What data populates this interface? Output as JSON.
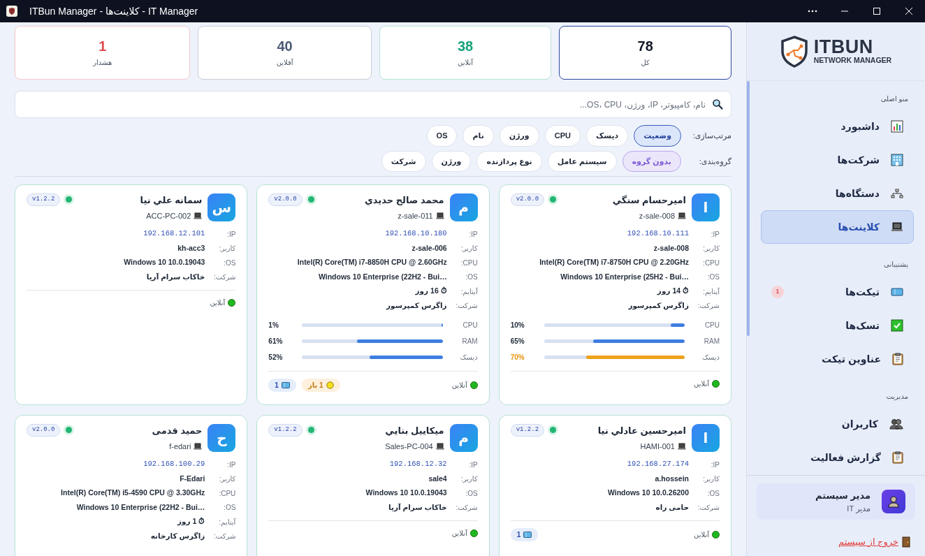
{
  "window": {
    "title": "ITBun Manager - کلاینت‌ها - IT Manager"
  },
  "stats": [
    {
      "value": "78",
      "label": "کل",
      "color": "#111827",
      "selected": true
    },
    {
      "value": "38",
      "label": "آنلاین",
      "color": "#16a37a",
      "selected": false
    },
    {
      "value": "40",
      "label": "آفلاین",
      "color": "#4b5a75",
      "selected": false
    },
    {
      "value": "1",
      "label": "هشدار",
      "color": "#e14b50",
      "selected": false
    }
  ],
  "search": {
    "placeholder": "نام، کامپیوتر، IP، ورژن، OS، CPU..."
  },
  "sort": {
    "label": "مرتب‌سازی:",
    "options": [
      {
        "label": "وضعیت",
        "selected": true
      },
      {
        "label": "دیسک",
        "selected": false
      },
      {
        "label": "CPU",
        "selected": false
      },
      {
        "label": "ورژن",
        "selected": false
      },
      {
        "label": "نام",
        "selected": false
      },
      {
        "label": "OS",
        "selected": false
      }
    ]
  },
  "grouping": {
    "label": "گروه‌بندی:",
    "options": [
      {
        "label": "بدون گروه",
        "selected": true
      },
      {
        "label": "سیستم عامل",
        "selected": false
      },
      {
        "label": "نوع پردازنده",
        "selected": false
      },
      {
        "label": "ورژن",
        "selected": false
      },
      {
        "label": "شرکت",
        "selected": false
      }
    ]
  },
  "clients": [
    {
      "initial": "ا",
      "name": "امیرحسام سنگي",
      "host": "z-sale-008",
      "version": "v2.0.0",
      "online": true,
      "fields": [
        {
          "label": "IP:",
          "value": "192.168.10.111",
          "kind": "ip"
        },
        {
          "label": "کاربر:",
          "value": "z-sale-008",
          "kind": "text"
        },
        {
          "label": "CPU:",
          "value": "Intel(R) Core(TM) i7-8750H CPU @ 2.20GHz",
          "kind": "text"
        },
        {
          "label": "OS:",
          "value": "Windows 10 Enterprise (25H2 - Bui…",
          "kind": "text"
        },
        {
          "label": "آپتایم:",
          "value": "⏱ 14 روز",
          "kind": "text"
        },
        {
          "label": "شرکت:",
          "value": "زاگرس کمپرسور",
          "kind": "text"
        }
      ],
      "metrics": [
        {
          "label": "CPU",
          "level": 0.1,
          "reading": "10%",
          "warning": false
        },
        {
          "label": "RAM",
          "level": 0.65,
          "reading": "65%",
          "warning": false
        },
        {
          "label": "دیسک",
          "level": 0.7,
          "reading": "70%",
          "warning": true
        }
      ],
      "status": "آنلاین"
    },
    {
      "initial": "م",
      "name": "محمد صالح حديدي",
      "host": "z-sale-011",
      "version": "v2.0.0",
      "online": true,
      "fields": [
        {
          "label": "IP:",
          "value": "192.168.10.180",
          "kind": "ip"
        },
        {
          "label": "کاربر:",
          "value": "z-sale-006",
          "kind": "text"
        },
        {
          "label": "CPU:",
          "value": "Intel(R) Core(TM) i7-8850H CPU @ 2.60GHz",
          "kind": "text"
        },
        {
          "label": "OS:",
          "value": "Windows 10 Enterprise (22H2 - Bui…",
          "kind": "text"
        },
        {
          "label": "آپتایم:",
          "value": "⏱ 16 روز",
          "kind": "text"
        },
        {
          "label": "شرکت:",
          "value": "زاگرس کمپرسور",
          "kind": "text"
        }
      ],
      "metrics": [
        {
          "label": "CPU",
          "level": 0.01,
          "reading": "1%",
          "warning": false
        },
        {
          "label": "RAM",
          "level": 0.61,
          "reading": "61%",
          "warning": false
        },
        {
          "label": "دیسک",
          "level": 0.52,
          "reading": "52%",
          "warning": false
        }
      ],
      "status": "آنلاین",
      "badges": [
        {
          "kind": "open",
          "text": "1 باز"
        },
        {
          "kind": "tickets",
          "text": "1"
        }
      ]
    },
    {
      "initial": "س",
      "name": "سمانه علي نيا",
      "host": "ACC-PC-002",
      "version": "v1.2.2",
      "online": true,
      "fields": [
        {
          "label": "IP:",
          "value": "192.168.12.101",
          "kind": "ip"
        },
        {
          "label": "کاربر:",
          "value": "kh-acc3",
          "kind": "text"
        },
        {
          "label": "OS:",
          "value": "Windows 10 10.0.19043",
          "kind": "text"
        },
        {
          "label": "شرکت:",
          "value": "خاکاب سرام آریا",
          "kind": "text"
        }
      ],
      "status": "آنلاین"
    },
    {
      "initial": "ا",
      "name": "امیرحسین عادلي نيا",
      "host": "HAMI-001",
      "version": "v1.2.2",
      "online": true,
      "fields": [
        {
          "label": "IP:",
          "value": "192.168.27.174",
          "kind": "ip"
        },
        {
          "label": "کاربر:",
          "value": "a.hossein",
          "kind": "text"
        },
        {
          "label": "OS:",
          "value": "Windows 10 10.0.26200",
          "kind": "text"
        },
        {
          "label": "شرکت:",
          "value": "حامی راه",
          "kind": "text"
        }
      ],
      "status": "آنلاین",
      "badges": [
        {
          "kind": "tickets",
          "text": "1"
        }
      ]
    },
    {
      "initial": "م",
      "name": "ميكاييل بنايي",
      "host": "Sales-PC-004",
      "version": "v1.2.2",
      "online": true,
      "fields": [
        {
          "label": "IP:",
          "value": "192.168.12.32",
          "kind": "ip"
        },
        {
          "label": "کاربر:",
          "value": "sale4",
          "kind": "text"
        },
        {
          "label": "OS:",
          "value": "Windows 10 10.0.19043",
          "kind": "text"
        },
        {
          "label": "شرکت:",
          "value": "خاکاب سرام آریا",
          "kind": "text"
        }
      ],
      "status": "آنلاین"
    },
    {
      "initial": "ح",
      "name": "حمید قدمی",
      "host": "f-edari",
      "version": "v2.0.0",
      "online": true,
      "fields": [
        {
          "label": "IP:",
          "value": "192.168.100.29",
          "kind": "ip"
        },
        {
          "label": "کاربر:",
          "value": "F-Edari",
          "kind": "text"
        },
        {
          "label": "CPU:",
          "value": "Intel(R) Core(TM) i5-4590 CPU @ 3.30GHz",
          "kind": "text"
        },
        {
          "label": "OS:",
          "value": "Windows 10 Enterprise (22H2 - Bui…",
          "kind": "text"
        },
        {
          "label": "آپتایم:",
          "value": "⏱ 1 روز",
          "kind": "text"
        },
        {
          "label": "شرکت:",
          "value": "زاگرس کارخانه",
          "kind": "text"
        }
      ]
    }
  ],
  "sidebar": {
    "logo": {
      "title": "ITBUN",
      "subtitle": "NETWORK MANAGER"
    },
    "sections": [
      {
        "title": "منو اصلی",
        "items": [
          {
            "label": "داشبورد",
            "selected": false
          },
          {
            "label": "شرکت‌ها",
            "selected": false
          },
          {
            "label": "دستگاه‌ها",
            "selected": false
          },
          {
            "label": "کلاینت‌ها",
            "selected": true
          }
        ]
      },
      {
        "title": "پشتیبانی",
        "items": [
          {
            "label": "تیکت‌ها",
            "selected": false,
            "badge": "1"
          },
          {
            "label": "تسک‌ها",
            "selected": false
          },
          {
            "label": "عناوین تیکت",
            "selected": false
          }
        ]
      },
      {
        "title": "مدیریت",
        "items": [
          {
            "label": "کاربران",
            "selected": false
          },
          {
            "label": "گزارش فعالیت",
            "selected": false
          }
        ]
      }
    ],
    "user": {
      "name": "مدیر سیستم",
      "role": "مدیر IT"
    },
    "logout": "خروج از سیستم"
  }
}
